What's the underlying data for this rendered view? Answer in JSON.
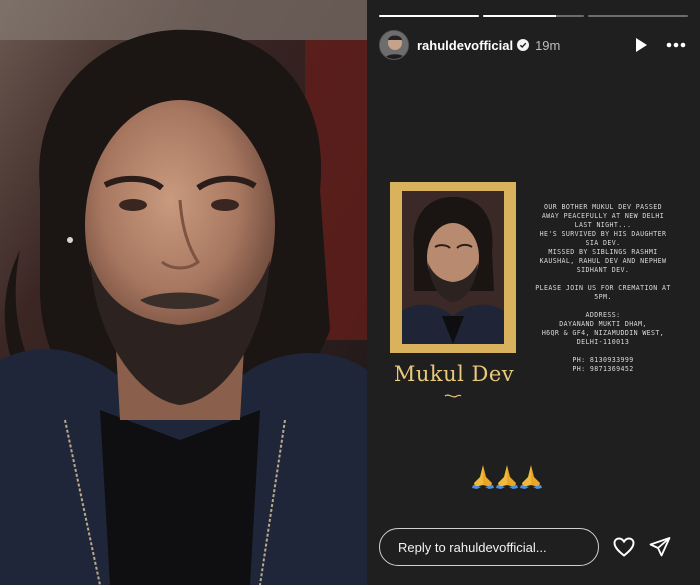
{
  "story": {
    "progress": [
      1.0,
      0.72,
      0.0
    ],
    "username": "rahuldevofficial",
    "time": "19m",
    "icons": {
      "verified": "verified-badge-icon",
      "play": "play-icon",
      "more": "more-options-icon"
    }
  },
  "card": {
    "name": "Mukul Dev",
    "announcement": [
      "OUR BOTHER MUKUL DEV PASSED",
      "AWAY PEACEFULLY AT NEW DELHI",
      "LAST NIGHT...",
      "HE'S SURVIVED BY HIS DAUGHTER",
      "SIA DEV.",
      "MISSED BY SIBLINGS RASHMI",
      "KAUSHAL, RAHUL DEV AND NEPHEW",
      "SIDHANT DEV.",
      "",
      "PLEASE JOIN US FOR CREMATION AT",
      "5PM.",
      "",
      "ADDRESS:",
      "DAYANAND MUKTI DHAM,",
      "H6QR & GF4, NIZAMUDDIN WEST,",
      "DELHI-110013",
      "",
      "PH: 8130933999",
      "PH: 9871369452"
    ],
    "emoji": "🙏🙏🙏"
  },
  "reply": {
    "placeholder": "Reply to rahuldevofficial..."
  },
  "colors": {
    "story_bg": "#1f1f1f",
    "frame_gold": "#d8b25d",
    "name_gold": "#e9c97a"
  }
}
